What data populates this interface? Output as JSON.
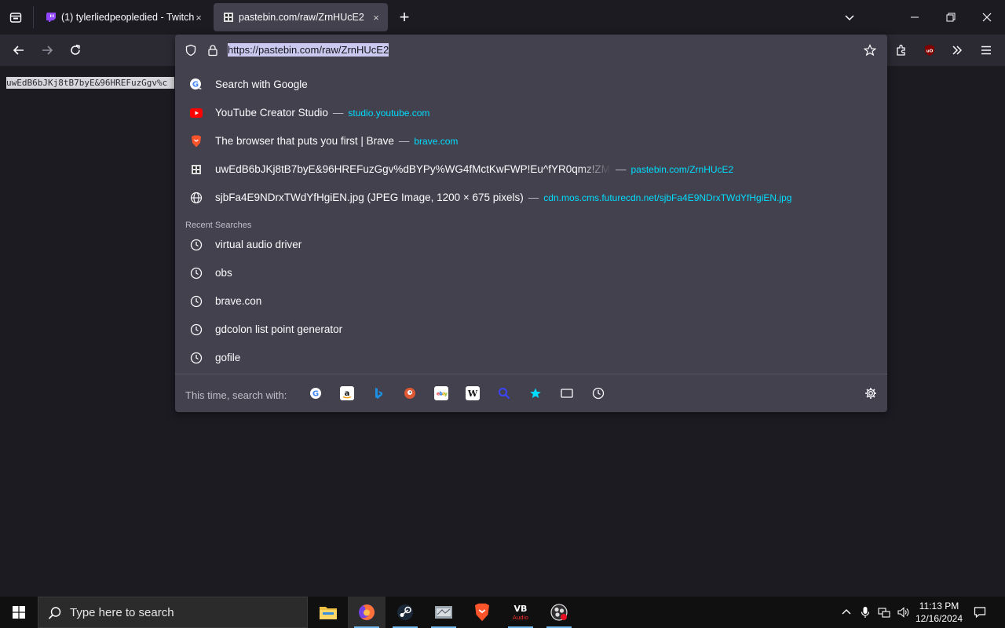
{
  "tabs": [
    {
      "title": "(1) tylerliedpeopledied - Twitch",
      "close": "×"
    },
    {
      "title": "pastebin.com/raw/ZrnHUcE2",
      "close": "×"
    }
  ],
  "new_tab": "+",
  "urlbar": {
    "value": "https://pastebin.com/raw/ZrnHUcE2"
  },
  "page": {
    "paste_text": "uwEdB6bJKj8tB7byE&96HREFuzGgv%c"
  },
  "dropdown": {
    "results": [
      {
        "title": "Search with Google",
        "sep": "",
        "url": "",
        "icon": "google-icon"
      },
      {
        "title": "YouTube Creator Studio",
        "sep": "—",
        "url": "studio.youtube.com",
        "icon": "youtube-icon"
      },
      {
        "title": "The browser that puts you first | Brave",
        "sep": "—",
        "url": "brave.com",
        "icon": "brave-icon"
      },
      {
        "title": "uwEdB6bJKj8tB7byE&96HREFuzGgv%dBYPy%WG4fMctKwFWP!Eu^fYR0qmz!ZMb",
        "sep": "—",
        "url": "pastebin.com/ZrnHUcE2",
        "icon": "pastebin-icon"
      },
      {
        "title": "sjbFa4E9NDrxTWdYfHgiEN.jpg (JPEG Image, 1200 × 675 pixels)",
        "sep": "—",
        "url": "cdn.mos.cms.futurecdn.net/sjbFa4E9NDrxTWdYfHgiEN.jpg",
        "icon": "globe-icon"
      }
    ],
    "recent_heading": "Recent Searches",
    "recent": [
      "virtual audio driver",
      "obs",
      "brave.con",
      "gdcolon list point generator",
      "gofile"
    ],
    "search_with_label": "This time, search with:"
  },
  "taskbar": {
    "search_placeholder": "Type here to search",
    "time": "11:13 PM",
    "date": "12/16/2024"
  },
  "colors": {
    "accent_url": "#00ddff",
    "selection": "#ccc9f0",
    "panel": "#42414d"
  }
}
